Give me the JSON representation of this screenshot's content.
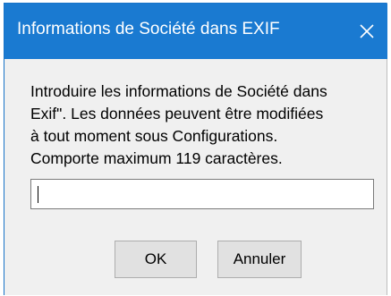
{
  "window": {
    "title": "Informations de Société dans EXIF",
    "close_glyph": "✕"
  },
  "message": {
    "lines": [
      "Introduire les informations de Société dans",
      "Exif\". Les données peuvent être modifiées",
      "à tout moment sous Configurations.",
      "Comporte maximum 119 caractères."
    ]
  },
  "input": {
    "value": "",
    "placeholder": ""
  },
  "buttons": {
    "ok_label": "OK",
    "cancel_label": "Annuler"
  },
  "colors": {
    "titlebar": "#1a7ad1",
    "dialog_background": "#f0f0f0",
    "button_face": "#e1e1e1"
  },
  "icons": {
    "close": "close-icon"
  }
}
